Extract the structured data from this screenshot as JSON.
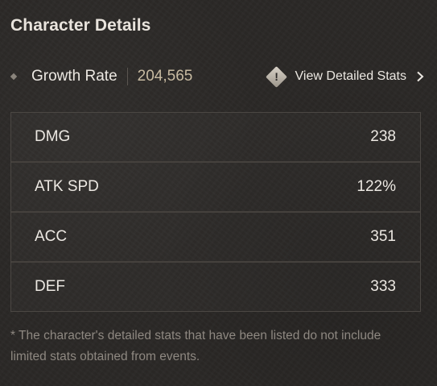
{
  "title": "Character Details",
  "growth": {
    "label": "Growth Rate",
    "value": "204,565"
  },
  "detail_link": {
    "icon": "warning-diamond-icon",
    "label": "View Detailed Stats",
    "chevron": "chevron-right-icon"
  },
  "stats": [
    {
      "name": "DMG",
      "value": "238"
    },
    {
      "name": "ATK SPD",
      "value": "122%"
    },
    {
      "name": "ACC",
      "value": "351"
    },
    {
      "name": "DEF",
      "value": "333"
    }
  ],
  "footnote": "* The character's detailed stats that have been listed do not include limited stats obtained from events.",
  "colors": {
    "background": "#2b2826",
    "text": "#ece8e2",
    "accent_value": "#c8bba2",
    "muted": "#8e8881",
    "border": "#4b4743"
  }
}
